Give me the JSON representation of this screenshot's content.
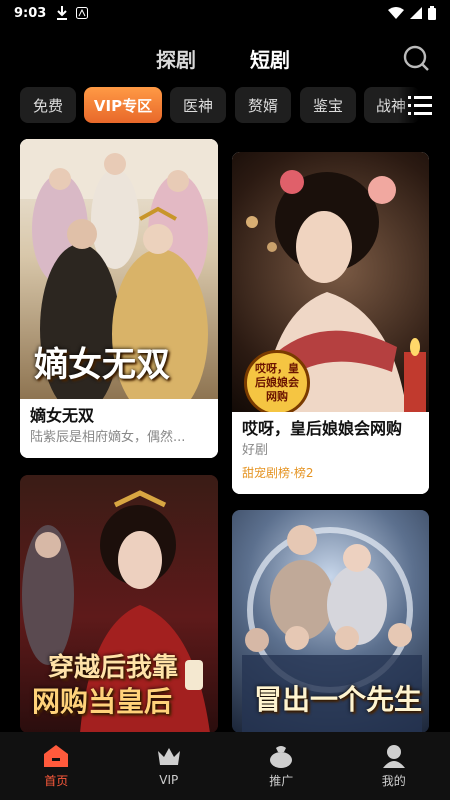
{
  "status_bar": {
    "time": "9:03"
  },
  "header": {
    "tabs": [
      {
        "label": "探剧"
      },
      {
        "label": "短剧"
      }
    ]
  },
  "chips": [
    {
      "label": "免费"
    },
    {
      "label": "VIP专区"
    },
    {
      "label": "医神"
    },
    {
      "label": "赘婿"
    },
    {
      "label": "鉴宝"
    },
    {
      "label": "战神"
    }
  ],
  "cards": [
    {
      "title": "嫡女无双",
      "poster_text": "嫡女无双",
      "desc": "陆紫辰是相府嫡女，偶然..."
    },
    {
      "title": "哎呀，皇后娘娘会网购",
      "stamp_text": "哎呀，皇后娘娘会网购",
      "desc": "好剧",
      "rank": "甜宠剧榜·榜2"
    },
    {
      "poster_text_line1": "穿越后我靠",
      "poster_text_line2": "网购当皇后"
    },
    {
      "poster_text": "冒出一个先生"
    }
  ],
  "bottom_nav": [
    {
      "label": "首页",
      "icon": "home-icon"
    },
    {
      "label": "VIP",
      "icon": "crown-icon"
    },
    {
      "label": "推广",
      "icon": "bag-icon"
    },
    {
      "label": "我的",
      "icon": "user-icon"
    }
  ],
  "colors": {
    "accent": "#ff5a3c",
    "chip_active": "#ef7a33",
    "rank": "#e59423"
  }
}
